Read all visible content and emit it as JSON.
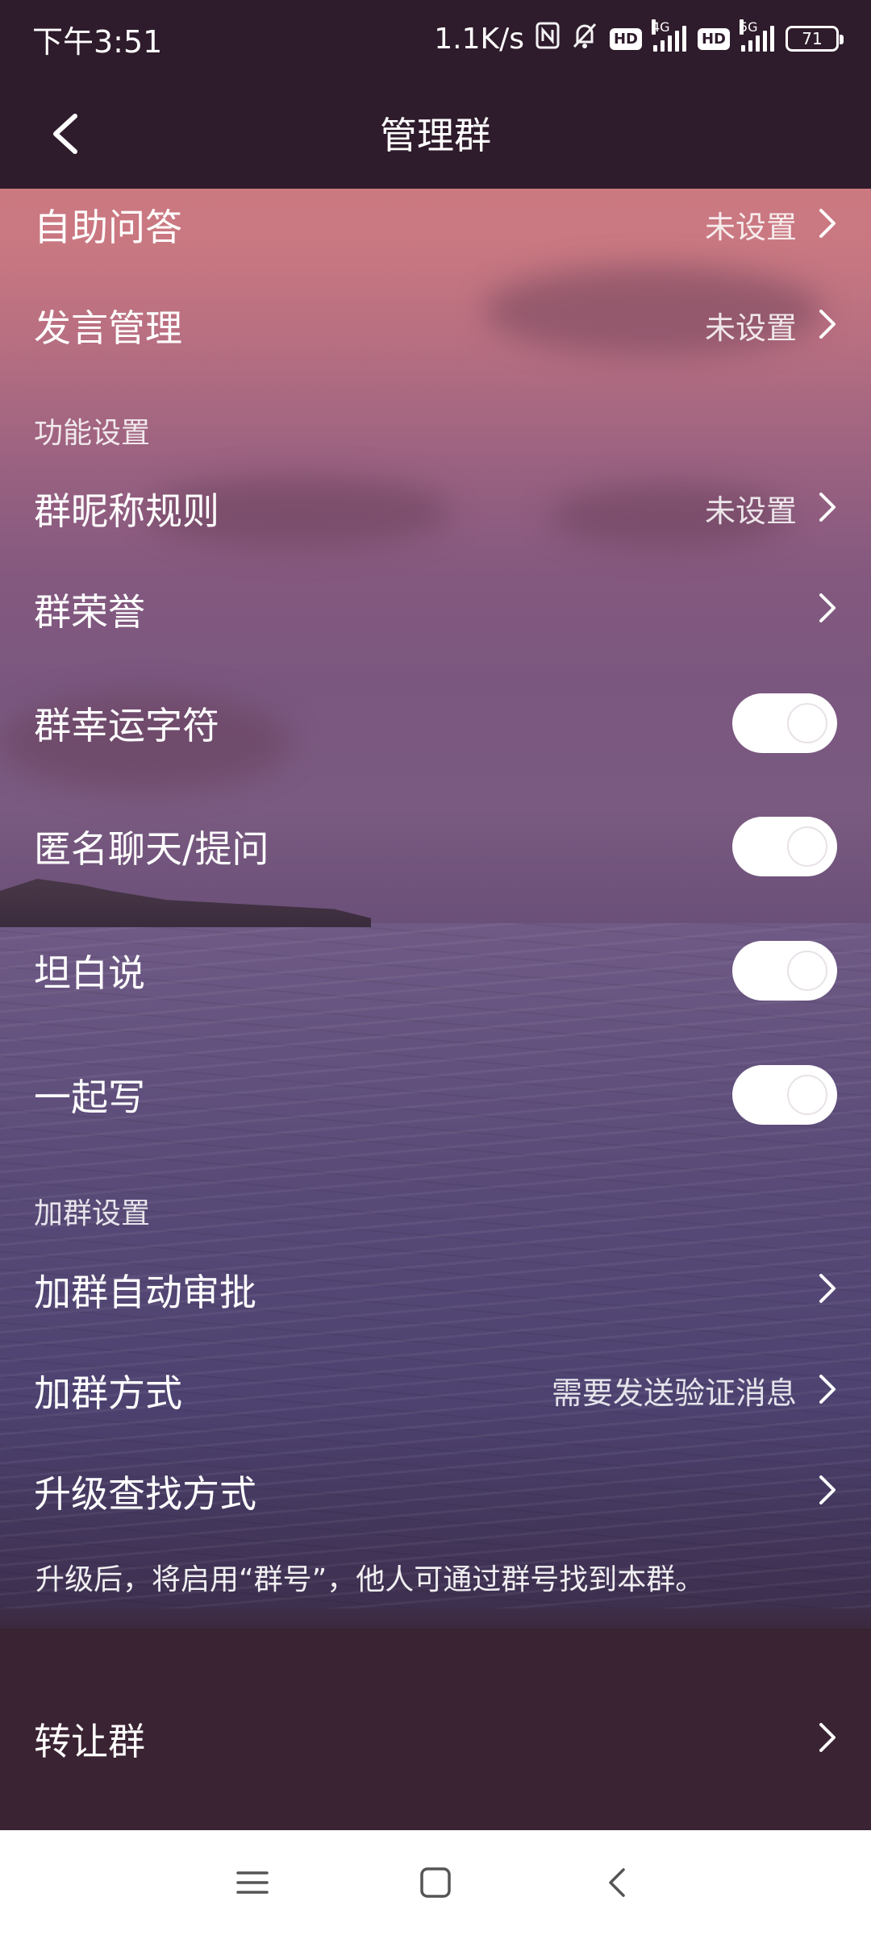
{
  "status_bar": {
    "time": "下午3:51",
    "net_speed": "1.1K/s",
    "nfc_icon": "nfc-icon",
    "mute_icon": "bell-off-icon",
    "hd1": "HD",
    "sig1_label": "4G",
    "hd2": "HD",
    "sig2_label": "5G",
    "battery": "71"
  },
  "header": {
    "title": "管理群",
    "back_icon": "chevron-left-icon"
  },
  "rows": {
    "qa": {
      "label": "自助问答",
      "value": "未设置"
    },
    "speech": {
      "label": "发言管理",
      "value": "未设置"
    },
    "nickname": {
      "label": "群昵称规则",
      "value": "未设置"
    },
    "honor": {
      "label": "群荣誉"
    },
    "lucky": {
      "label": "群幸运字符"
    },
    "anon": {
      "label": "匿名聊天/提问"
    },
    "frank": {
      "label": "坦白说"
    },
    "together": {
      "label": "一起写"
    },
    "auto_approve": {
      "label": "加群自动审批"
    },
    "join_method": {
      "label": "加群方式",
      "value": "需要发送验证消息"
    },
    "upgrade": {
      "label": "升级查找方式"
    },
    "transfer": {
      "label": "转让群"
    }
  },
  "sections": {
    "features": "功能设置",
    "join": "加群设置"
  },
  "note": "升级后，将启用“群号”，他人可通过群号找到本群。",
  "navbar": {
    "menu_icon": "menu-icon",
    "home_icon": "square-icon",
    "back_icon": "back-triangle-icon"
  }
}
